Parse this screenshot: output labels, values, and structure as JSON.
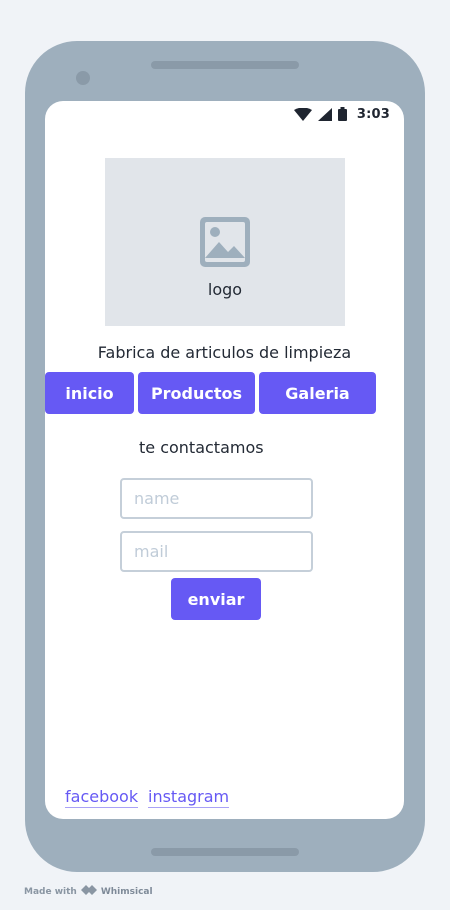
{
  "status_bar": {
    "time": "3:03",
    "icons": [
      "wifi-icon",
      "signal-icon",
      "battery-icon"
    ]
  },
  "logo": {
    "label": "logo",
    "icon": "image-placeholder-icon"
  },
  "tagline": "Fabrica de articulos de limpieza",
  "nav": {
    "inicio": "inicio",
    "productos": "Productos",
    "galeria": "Galeria"
  },
  "contact": {
    "heading": "te contactamos",
    "name_placeholder": "name",
    "mail_placeholder": "mail",
    "send_label": "enviar"
  },
  "footer": {
    "facebook": "facebook",
    "instagram": "instagram"
  },
  "watermark": {
    "prefix": "Made with",
    "brand": "Whimsical"
  },
  "colors": {
    "accent": "#6659f4",
    "device": "#9eafbd",
    "placeholder_bg": "#e1e5ea"
  }
}
